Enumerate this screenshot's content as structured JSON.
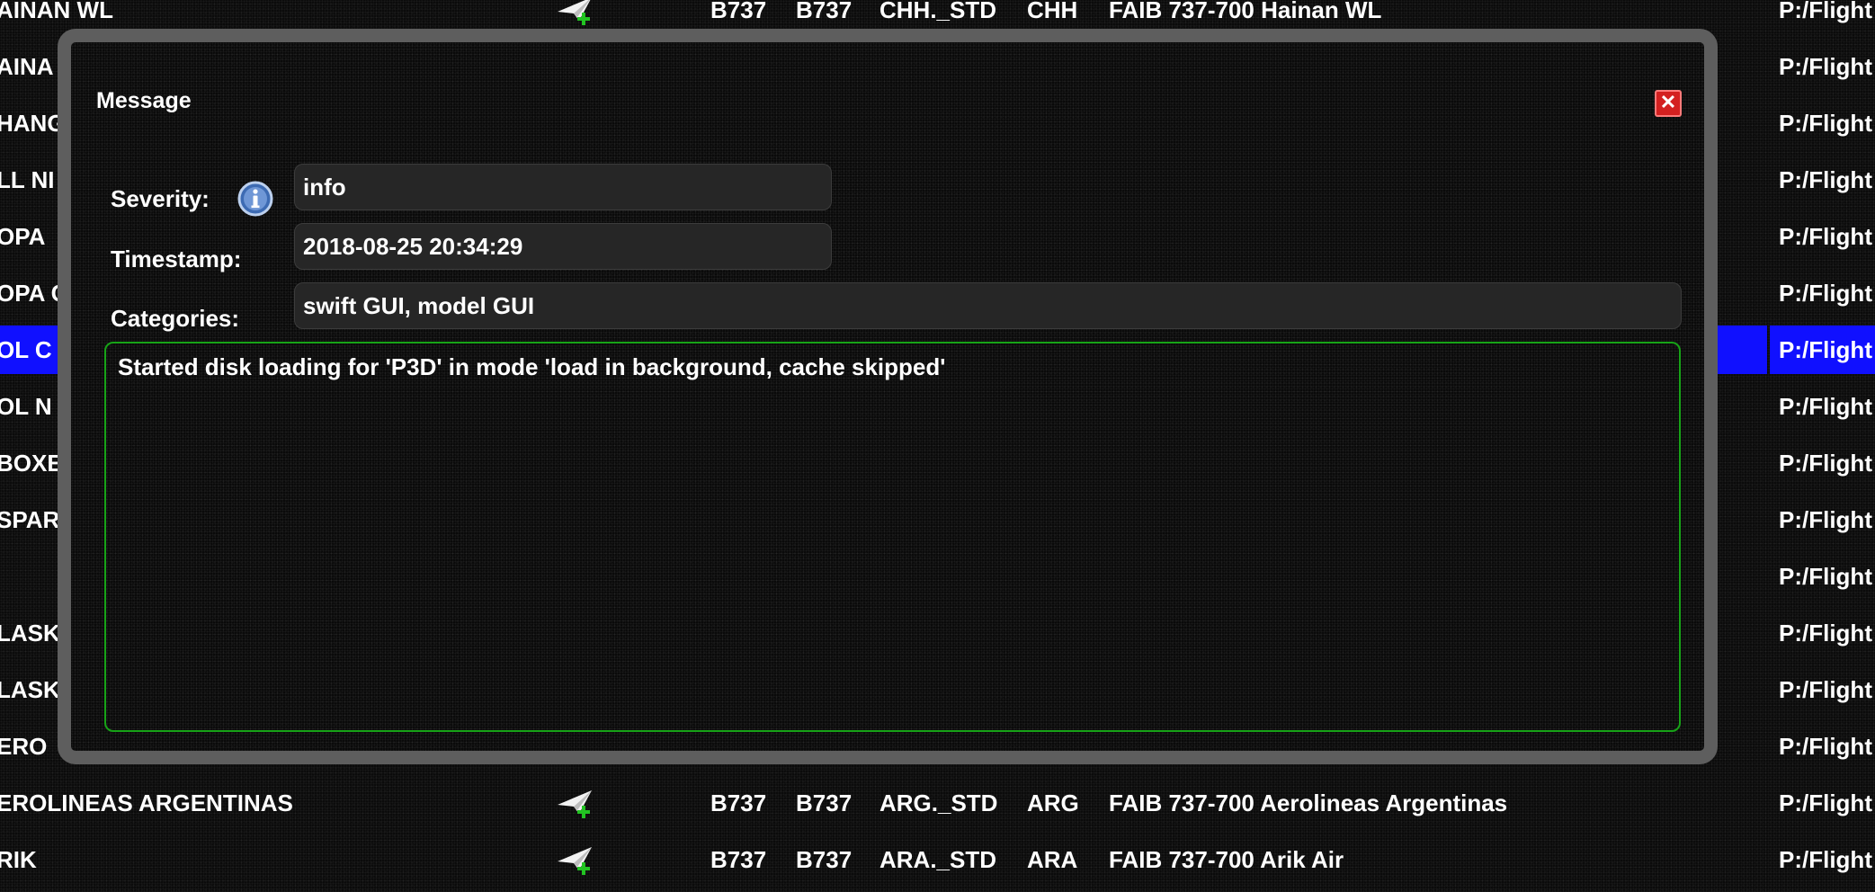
{
  "table": {
    "rows": [
      {
        "name": "AINAN WL",
        "icao": "B737",
        "combined": "B737",
        "model": "CHH._STD",
        "airline": "CHH",
        "desc": "FAIB 737-700 Hainan WL",
        "path": "P:/Flight"
      },
      {
        "name": "AINA",
        "path": "P:/Flight"
      },
      {
        "name": "HANG",
        "path": "P:/Flight"
      },
      {
        "name": "LL NI",
        "path": "P:/Flight"
      },
      {
        "name": "OPA",
        "path": "P:/Flight"
      },
      {
        "name": "OPA C",
        "path": "P:/Flight"
      },
      {
        "name": "OL C",
        "path": "P:/Flight",
        "selected": true
      },
      {
        "name": "OL N",
        "path": "P:/Flight"
      },
      {
        "name": "BOXE",
        "path": "P:/Flight"
      },
      {
        "name": "SPAR",
        "path": "P:/Flight"
      },
      {
        "name": "",
        "path": "P:/Flight"
      },
      {
        "name": "LASK",
        "path": "P:/Flight"
      },
      {
        "name": "LASK",
        "path": "P:/Flight"
      },
      {
        "name": "ERO",
        "path": "P:/Flight"
      },
      {
        "name": "EROLINEAS ARGENTINAS",
        "icao": "B737",
        "combined": "B737",
        "model": "ARG._STD",
        "airline": "ARG",
        "desc": "FAIB 737-700 Aerolineas Argentinas",
        "path": "P:/Flight"
      },
      {
        "name": "RIK",
        "icao": "B737",
        "combined": "B737",
        "model": "ARA._STD",
        "airline": "ARA",
        "desc": "FAIB 737-700 Arik Air",
        "path": "P:/Flight"
      }
    ]
  },
  "dialog": {
    "title": "Message",
    "close_icon": "close-icon",
    "severity_label": "Severity:",
    "severity_icon": "info-icon",
    "severity_value": "info",
    "timestamp_label": "Timestamp:",
    "timestamp_value": "2018-08-25 20:34:29",
    "categories_label": "Categories:",
    "categories_value": "swift GUI, model GUI",
    "message": "Started disk loading for 'P3D' in mode 'load in background, cache skipped'"
  },
  "colors": {
    "selection": "#1010ff",
    "message_border": "#17a317",
    "close_button": "#d42020"
  }
}
